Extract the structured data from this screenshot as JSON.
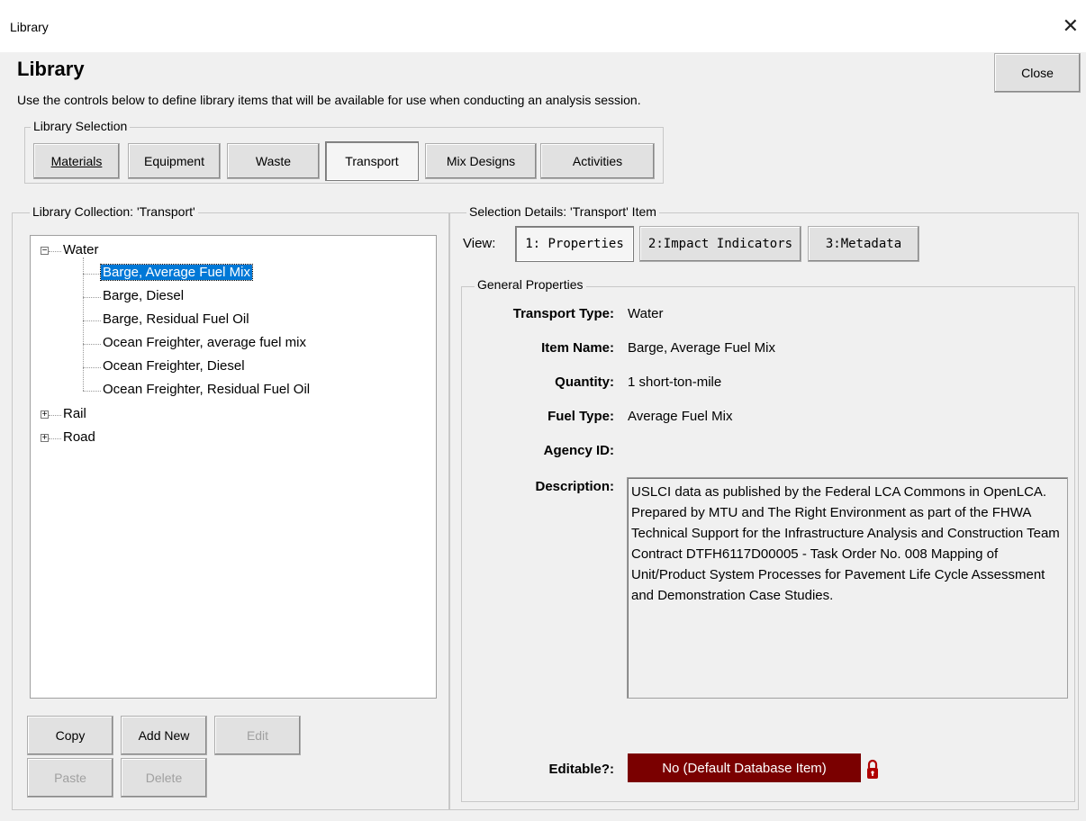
{
  "window": {
    "title": "Library",
    "close_glyph": "✕"
  },
  "heading": "Library",
  "instructions": "Use the controls below to define library items that will be available for use when conducting an analysis session.",
  "close_button": {
    "label": "Close",
    "accel": "o"
  },
  "library_selection": {
    "legend": "Library Selection",
    "buttons": [
      {
        "label": "Materials",
        "active": false
      },
      {
        "label": "Equipment",
        "active": false
      },
      {
        "label": "Waste",
        "active": false
      },
      {
        "label": "Transport",
        "active": true
      },
      {
        "label": "Mix Designs",
        "active": false
      },
      {
        "label": "Activities",
        "active": false
      }
    ]
  },
  "collection": {
    "legend": "Library Collection: 'Transport'",
    "tree": {
      "water": {
        "label": "Water",
        "expanded": true
      },
      "water_children": [
        "Barge, Average Fuel Mix",
        "Barge, Diesel",
        "Barge, Residual Fuel Oil",
        "Ocean Freighter, average fuel mix",
        "Ocean Freighter, Diesel",
        "Ocean Freighter, Residual Fuel  Oil"
      ],
      "selected": "Barge, Average Fuel Mix",
      "rail": {
        "label": "Rail",
        "expanded": false
      },
      "road": {
        "label": "Road",
        "expanded": false
      }
    },
    "buttons": {
      "copy": "Copy",
      "add_new": "Add New",
      "edit": "Edit",
      "paste": "Paste",
      "delete": "Delete"
    }
  },
  "details": {
    "legend": "Selection Details: 'Transport' Item",
    "view_label": "View:",
    "view_buttons": {
      "properties": "1: Properties",
      "impact": "2:Impact Indicators",
      "metadata": "3:Metadata"
    },
    "general_legend": "General Properties",
    "labels": {
      "transport_type": "Transport Type:",
      "item_name": "Item Name:",
      "quantity": "Quantity:",
      "fuel_type": "Fuel Type:",
      "agency_id": "Agency ID:",
      "description": "Description:",
      "editable": "Editable?:"
    },
    "values": {
      "transport_type": "Water",
      "item_name": "Barge, Average Fuel Mix",
      "quantity": "1 short-ton-mile",
      "fuel_type": "Average Fuel Mix",
      "agency_id": "",
      "description": "USLCI data as published by the Federal LCA Commons in OpenLCA. Prepared by MTU and The Right Environment as part of the FHWA Technical Support for the Infrastructure Analysis and Construction Team Contract DTFH6117D00005 - Task Order No. 008 Mapping of Unit/Product System Processes for Pavement Life Cycle Assessment and Demonstration Case Studies.",
      "editable": "No (Default Database Item)"
    },
    "colors": {
      "editable_bg": "#7a0000",
      "lock": "#b00000",
      "selection": "#0078d7"
    }
  }
}
